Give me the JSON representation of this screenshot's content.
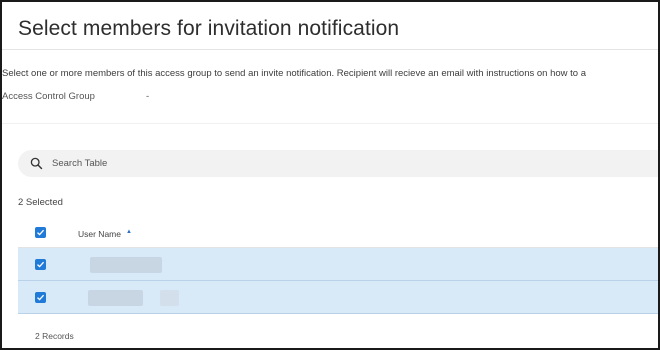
{
  "dialog": {
    "title": "Select members for invitation notification",
    "description": "Select one or more members of this access group to send an invite notification. Recipient will recieve an email with instructions on how to a",
    "access_group_label": "Access Control Group",
    "access_group_value": "-"
  },
  "search": {
    "placeholder": "Search Table",
    "icon": "search-icon"
  },
  "table": {
    "selected_count": "2 Selected",
    "columns": [
      "User Name"
    ],
    "sort": "ascending",
    "rows": [
      {
        "user_name": "",
        "selected": true
      },
      {
        "user_name": "",
        "selected": true
      }
    ],
    "records": "2 Records"
  },
  "colors": {
    "accent": "#1f7ad8",
    "selected_row": "#d8e9f8",
    "search_bg": "#f2f2f2"
  }
}
